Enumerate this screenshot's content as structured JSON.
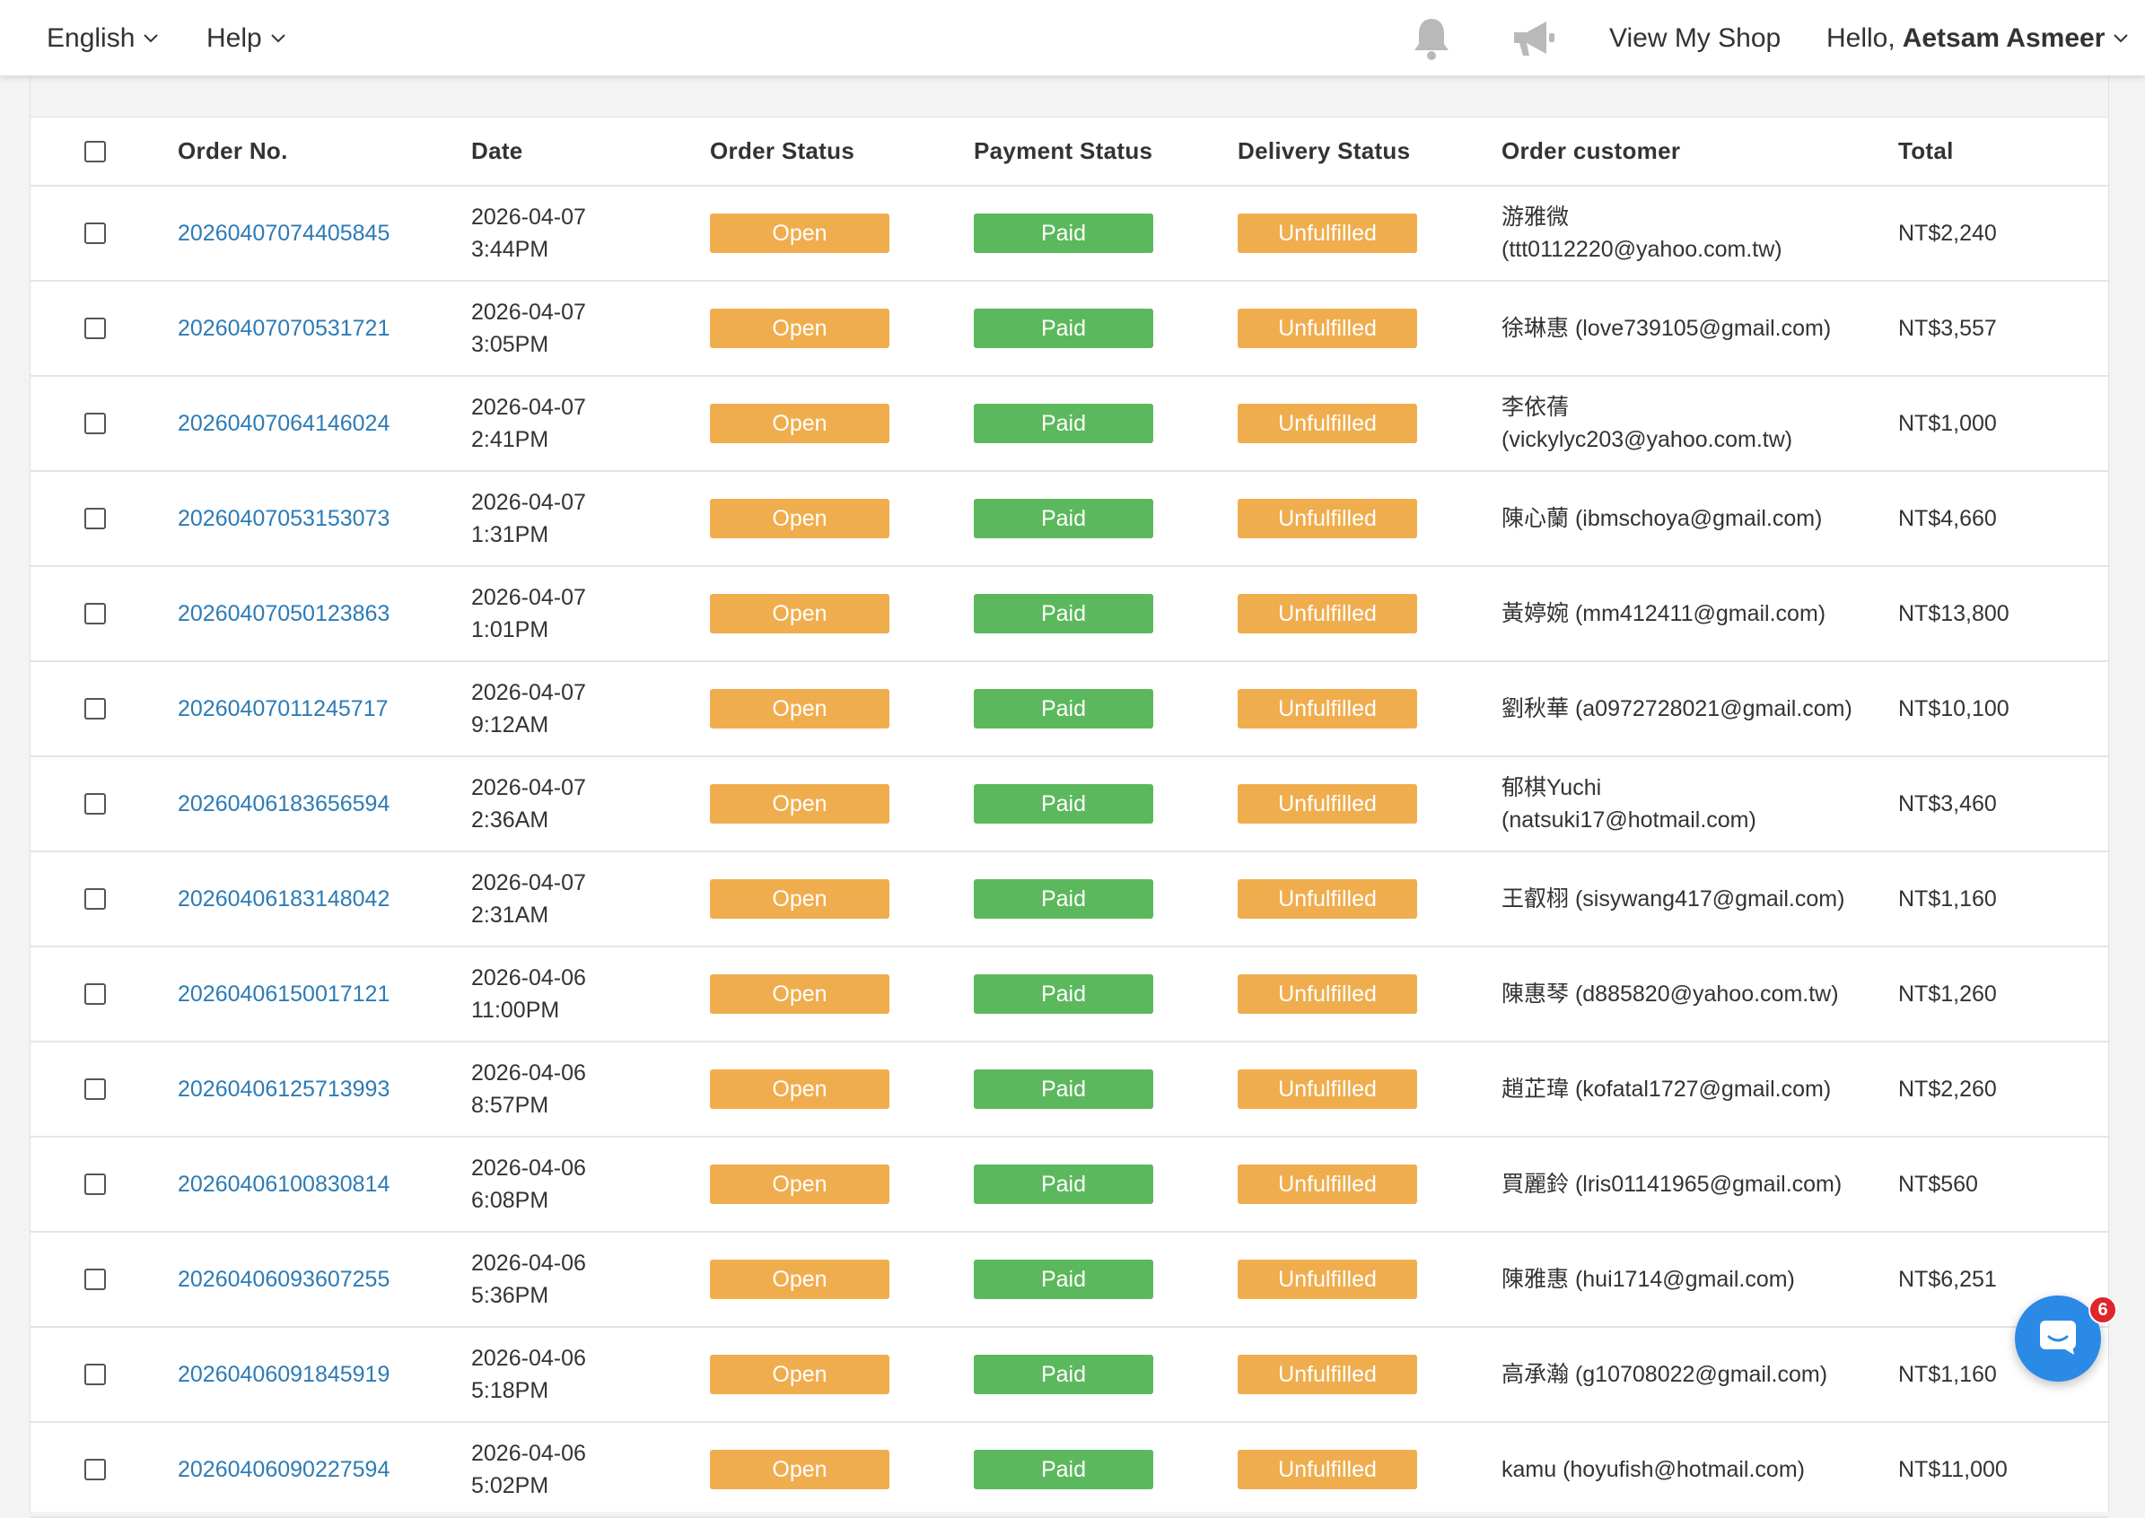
{
  "topbar": {
    "language": "English",
    "help": "Help",
    "view_shop": "View My Shop",
    "greeting": "Hello,",
    "user_name": "Aetsam Asmeer"
  },
  "table": {
    "headers": {
      "order_no": "Order No.",
      "date": "Date",
      "order_status": "Order Status",
      "payment_status": "Payment Status",
      "delivery_status": "Delivery Status",
      "customer": "Order customer",
      "total": "Total"
    },
    "rows": [
      {
        "order_no": "20260407074405845",
        "date": "2026-04-07",
        "time": "3:44PM",
        "order_status": "Open",
        "payment_status": "Paid",
        "delivery_status": "Unfulfilled",
        "customer_line1": "游雅微",
        "customer_line2": "(ttt0112220@yahoo.com.tw)",
        "total": "NT$2,240"
      },
      {
        "order_no": "20260407070531721",
        "date": "2026-04-07",
        "time": "3:05PM",
        "order_status": "Open",
        "payment_status": "Paid",
        "delivery_status": "Unfulfilled",
        "customer_line1": "徐琳惠 (love739105@gmail.com)",
        "customer_line2": "",
        "total": "NT$3,557"
      },
      {
        "order_no": "20260407064146024",
        "date": "2026-04-07",
        "time": "2:41PM",
        "order_status": "Open",
        "payment_status": "Paid",
        "delivery_status": "Unfulfilled",
        "customer_line1": "李依蒨",
        "customer_line2": "(vickylyc203@yahoo.com.tw)",
        "total": "NT$1,000"
      },
      {
        "order_no": "20260407053153073",
        "date": "2026-04-07",
        "time": "1:31PM",
        "order_status": "Open",
        "payment_status": "Paid",
        "delivery_status": "Unfulfilled",
        "customer_line1": "陳心蘭 (ibmschoya@gmail.com)",
        "customer_line2": "",
        "total": "NT$4,660"
      },
      {
        "order_no": "20260407050123863",
        "date": "2026-04-07",
        "time": "1:01PM",
        "order_status": "Open",
        "payment_status": "Paid",
        "delivery_status": "Unfulfilled",
        "customer_line1": "黃婷婉 (mm412411@gmail.com)",
        "customer_line2": "",
        "total": "NT$13,800"
      },
      {
        "order_no": "20260407011245717",
        "date": "2026-04-07",
        "time": "9:12AM",
        "order_status": "Open",
        "payment_status": "Paid",
        "delivery_status": "Unfulfilled",
        "customer_line1": "劉秋華 (a0972728021@gmail.com)",
        "customer_line2": "",
        "total": "NT$10,100"
      },
      {
        "order_no": "20260406183656594",
        "date": "2026-04-07",
        "time": "2:36AM",
        "order_status": "Open",
        "payment_status": "Paid",
        "delivery_status": "Unfulfilled",
        "customer_line1": "郁棋Yuchi",
        "customer_line2": "(natsuki17@hotmail.com)",
        "total": "NT$3,460"
      },
      {
        "order_no": "20260406183148042",
        "date": "2026-04-07",
        "time": "2:31AM",
        "order_status": "Open",
        "payment_status": "Paid",
        "delivery_status": "Unfulfilled",
        "customer_line1": "王叡栩 (sisywang417@gmail.com)",
        "customer_line2": "",
        "total": "NT$1,160"
      },
      {
        "order_no": "20260406150017121",
        "date": "2026-04-06",
        "time": "11:00PM",
        "order_status": "Open",
        "payment_status": "Paid",
        "delivery_status": "Unfulfilled",
        "customer_line1": "陳惠琴 (d885820@yahoo.com.tw)",
        "customer_line2": "",
        "total": "NT$1,260"
      },
      {
        "order_no": "20260406125713993",
        "date": "2026-04-06",
        "time": "8:57PM",
        "order_status": "Open",
        "payment_status": "Paid",
        "delivery_status": "Unfulfilled",
        "customer_line1": "趙芷瑋 (kofatal1727@gmail.com)",
        "customer_line2": "",
        "total": "NT$2,260"
      },
      {
        "order_no": "20260406100830814",
        "date": "2026-04-06",
        "time": "6:08PM",
        "order_status": "Open",
        "payment_status": "Paid",
        "delivery_status": "Unfulfilled",
        "customer_line1": "買麗鈴 (lris01141965@gmail.com)",
        "customer_line2": "",
        "total": "NT$560"
      },
      {
        "order_no": "20260406093607255",
        "date": "2026-04-06",
        "time": "5:36PM",
        "order_status": "Open",
        "payment_status": "Paid",
        "delivery_status": "Unfulfilled",
        "customer_line1": "陳雅惠 (hui1714@gmail.com)",
        "customer_line2": "",
        "total": "NT$6,251"
      },
      {
        "order_no": "20260406091845919",
        "date": "2026-04-06",
        "time": "5:18PM",
        "order_status": "Open",
        "payment_status": "Paid",
        "delivery_status": "Unfulfilled",
        "customer_line1": "高承瀚 (g10708022@gmail.com)",
        "customer_line2": "",
        "total": "NT$1,160"
      },
      {
        "order_no": "20260406090227594",
        "date": "2026-04-06",
        "time": "5:02PM",
        "order_status": "Open",
        "payment_status": "Paid",
        "delivery_status": "Unfulfilled",
        "customer_line1": "kamu (hoyufish@hotmail.com)",
        "customer_line2": "",
        "total": "NT$11,000"
      }
    ]
  },
  "chat": {
    "unread_count": "6"
  },
  "colors": {
    "link": "#2c7bb6",
    "open_badge": "#f0ad4e",
    "paid_badge": "#5cb85c",
    "unfulfilled_badge": "#f0ad4e",
    "chat_button": "#2b8ae6",
    "chat_badge": "#e0242c"
  },
  "icons": {
    "notifications": "bell-icon",
    "announcements": "megaphone-icon",
    "chat": "chat-icon",
    "dropdown": "chevron-down-icon"
  }
}
